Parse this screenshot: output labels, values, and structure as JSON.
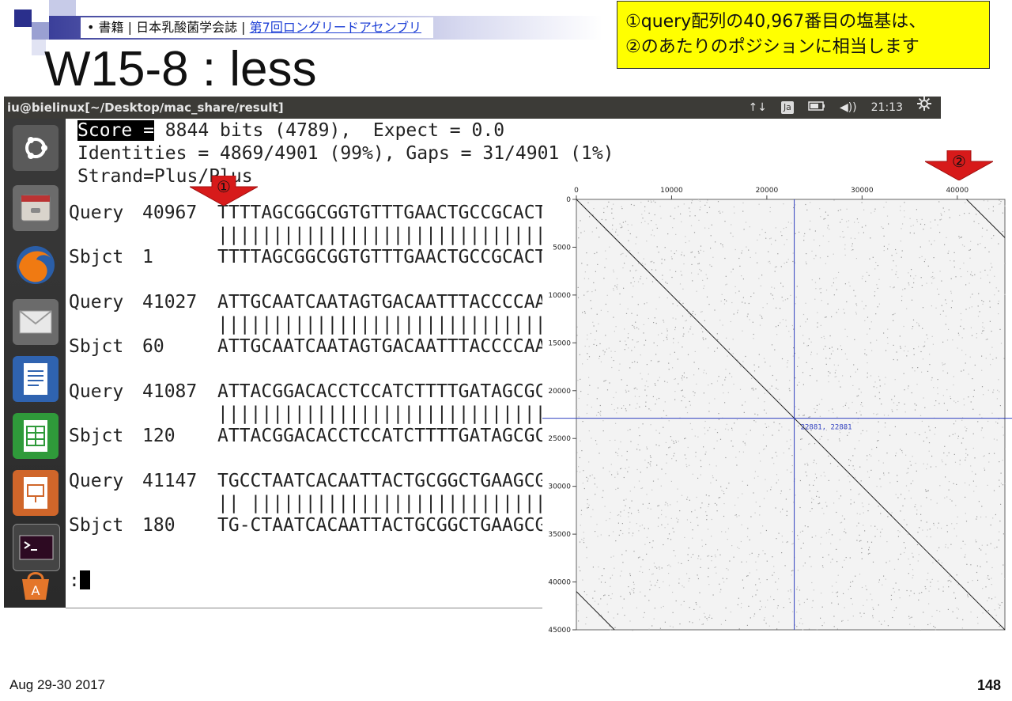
{
  "slide": {
    "breadcrumb_prefix": "• 書籍 | 日本乳酸菌学会誌 | ",
    "breadcrumb_link": "第7回ロングリードアセンブリ",
    "title": "W15-8 : less",
    "callout_line1": "①query配列の40,967番目の塩基は、",
    "callout_line2": "②のあたりのポジションに相当します",
    "arrow1_label": "①",
    "arrow2_label": "②",
    "date": "Aug 29-30 2017",
    "page_number": "148"
  },
  "window": {
    "title": "iu@bielinux[~/Desktop/mac_share/result]",
    "tray": {
      "network_icon": "↑↓",
      "keyboard": "Ja",
      "battery_icon": "battery-icon",
      "volume_icon": "◀))",
      "time": "21:13",
      "settings_icon": "gear-icon"
    }
  },
  "launcher": {
    "icons": [
      "dash-home-icon",
      "files-icon",
      "firefox-icon",
      "mail-icon",
      "writer-icon",
      "calc-icon",
      "impress-icon",
      "terminal-icon",
      "software-center-icon"
    ]
  },
  "terminal": {
    "score_key": "Score =",
    "score_rest": " 8844 bits (4789),  Expect = 0.0",
    "identities": "Identities = 4869/4901 (99%), Gaps = 31/4901 (1%)",
    "strand": "Strand=Plus/Plus",
    "alignment": [
      {
        "query_label": "Query",
        "query_pos": "40967",
        "query_seq": "TTTTAGCGGCGGTGTTTGAACTGCCGCACT",
        "match": "||||||||||||||||||||||||||||||",
        "sbjct_label": "Sbjct",
        "sbjct_pos": "1",
        "sbjct_seq": "TTTTAGCGGCGGTGTTTGAACTGCCGCACT"
      },
      {
        "query_label": "Query",
        "query_pos": "41027",
        "query_seq": "ATTGCAATCAATAGTGACAATTTACCCCAA",
        "match": "||||||||||||||||||||||||||||||",
        "sbjct_label": "Sbjct",
        "sbjct_pos": "60",
        "sbjct_seq": "ATTGCAATCAATAGTGACAATTTACCCCAA"
      },
      {
        "query_label": "Query",
        "query_pos": "41087",
        "query_seq": "ATTACGGACACCTCCATCTTTTGATAGCGC",
        "match": "||||||||||||||||||||||||||||||",
        "sbjct_label": "Sbjct",
        "sbjct_pos": "120",
        "sbjct_seq": "ATTACGGACACCTCCATCTTTTGATAGCGC"
      },
      {
        "query_label": "Query",
        "query_pos": "41147",
        "query_seq": "TGCCTAATCACAATTACTGCGGCTGAAGCG",
        "match": "|| |||||||||||||||||||||||||||",
        "sbjct_label": "Sbjct",
        "sbjct_pos": "180",
        "sbjct_seq": "TG-CTAATCACAATTACTGCGGCTGAAGCG"
      }
    ],
    "prompt": ":"
  },
  "dotplot": {
    "x_ticks": [
      "0",
      "10000",
      "20000",
      "30000",
      "40000"
    ],
    "y_ticks": [
      "0",
      "5000",
      "10000",
      "15000",
      "20000",
      "25000",
      "30000",
      "35000",
      "40000",
      "45000"
    ],
    "cursor_label": "22881, 22881",
    "colors": {
      "crosshair": "#3040c0",
      "diagonal": "#222222"
    }
  },
  "chart_data": {
    "type": "scatter",
    "xlim": [
      0,
      45000
    ],
    "ylim": [
      0,
      45000
    ],
    "x_ticks": [
      0,
      10000,
      20000,
      30000,
      40000
    ],
    "y_ticks": [
      0,
      5000,
      10000,
      15000,
      20000,
      25000,
      30000,
      35000,
      40000,
      45000
    ],
    "series": [
      {
        "values": [
          [
            0,
            0
          ],
          [
            45000,
            45000
          ]
        ]
      },
      {
        "values": [
          [
            40967,
            0
          ],
          [
            45000,
            4000
          ]
        ]
      },
      {
        "values": [
          [
            0,
            41000
          ],
          [
            4000,
            45000
          ]
        ]
      }
    ],
    "crosshair": [
      22881,
      22881
    ],
    "annotations": [
      "22881, 22881"
    ]
  }
}
